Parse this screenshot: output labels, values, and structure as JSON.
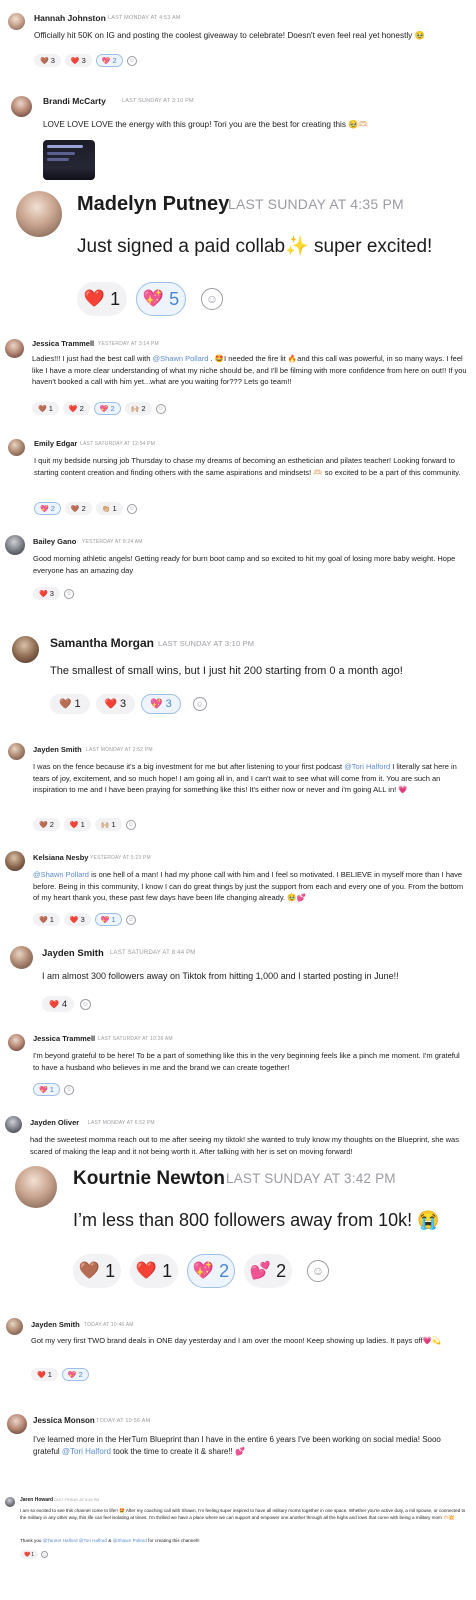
{
  "messages": [
    {
      "name": "Hannah Johnston",
      "time": "LAST MONDAY AT 4:53 AM",
      "text": "Officially hit 50K on IG and posting the coolest giveaway to celebrate! Doesn't even feel real yet honestly 🥹",
      "reactions": [
        {
          "emoji": "🤎",
          "count": "3",
          "mine": false
        },
        {
          "emoji": "❤️",
          "count": "3",
          "mine": false
        },
        {
          "emoji": "💖",
          "count": "2",
          "mine": true
        }
      ]
    },
    {
      "name": "Brandi McCarty",
      "time": "LAST SUNDAY AT 3:10 PM",
      "text": "LOVE LOVE LOVE the energy with this group! Tori you are the best for creating this 🥹🫶🏻",
      "reactions": []
    },
    {
      "name": "Madelyn Putney",
      "time": "LAST SUNDAY AT 4:35 PM",
      "text": "Just signed a paid collab✨ super excited!",
      "reactions": [
        {
          "emoji": "❤️",
          "count": "1",
          "mine": false
        },
        {
          "emoji": "💖",
          "count": "5",
          "mine": true
        }
      ]
    },
    {
      "name": "Jessica Trammell",
      "time": "YESTERDAY AT 3:14 PM",
      "text_a": "Ladies!!! I just had the best call with ",
      "mention": "@Shawn Pollard",
      "text_b": " . 🤩I needed the fire lit 🔥and this call was powerful, in so many ways. I feel like I have a more clear understanding of what my niche should be, and I'll be filming with more confidence from here on out!! If you haven't booked a call with him yet...what are you waiting for??? Lets go team!!",
      "reactions": [
        {
          "emoji": "🤎",
          "count": "1",
          "mine": false
        },
        {
          "emoji": "❤️",
          "count": "2",
          "mine": false
        },
        {
          "emoji": "💖",
          "count": "2",
          "mine": true
        },
        {
          "emoji": "🙌🏼",
          "count": "2",
          "mine": false
        }
      ]
    },
    {
      "name": "Emily Edgar",
      "time": "LAST SATURDAY AT 12:54 PM",
      "text": "I quit my bedside nursing job Thursday to chase my dreams of becoming an esthetician and pilates teacher! Looking forward to starting content creation and finding others with the same aspirations and mindsets! 🫶🏻 so excited to be a part of this community.",
      "reactions": [
        {
          "emoji": "💖",
          "count": "2",
          "mine": true
        },
        {
          "emoji": "🤎",
          "count": "2",
          "mine": false
        },
        {
          "emoji": "👏🏼",
          "count": "1",
          "mine": false
        }
      ]
    },
    {
      "name": "Bailey Gano",
      "time": "YESTERDAY AT 8:24 AM",
      "text": "Good morning athletic angels! Getting ready for burn boot camp and so excited to hit my goal of losing more baby weight. Hope everyone has an amazing day",
      "reactions": [
        {
          "emoji": "❤️",
          "count": "3",
          "mine": false
        }
      ]
    },
    {
      "name": "Samantha Morgan",
      "time": "LAST SUNDAY AT 3:10 PM",
      "text": "The smallest of small wins, but I just hit 200 starting from 0 a month ago!",
      "reactions": [
        {
          "emoji": "🤎",
          "count": "1",
          "mine": false
        },
        {
          "emoji": "❤️",
          "count": "3",
          "mine": false
        },
        {
          "emoji": "💖",
          "count": "3",
          "mine": true
        }
      ]
    },
    {
      "name": "Jayden Smith",
      "time": "LAST MONDAY AT 2:52 PM",
      "text_a": "I was on the fence because it's a big investment for me but after listening to your first podcast ",
      "mention": "@Tori Halford",
      "text_b": " I literally sat here in tears of joy, excitement, and so much hope! I am going all in, and I can't wait to see what will come from it. You are such an inspiration to me and I have been praying for something like this! It's either now or never and i'm going ALL in! 💗",
      "reactions": [
        {
          "emoji": "🤎",
          "count": "2",
          "mine": false
        },
        {
          "emoji": "❤️",
          "count": "1",
          "mine": false
        },
        {
          "emoji": "🙌🏼",
          "count": "1",
          "mine": false
        }
      ]
    },
    {
      "name": "Kelsiana Nesby",
      "time": "YESTERDAY AT 5:23 PM",
      "mention": "@Shawn Pollard",
      "text_b": " is one hell of a man! I had my phone call with him and I feel so motivated. I BELIEVE in myself more than I have before. Being in this community, I know I can do great things by just the support from each and every one of you. From the bottom of my heart thank you, these past few days have been life changing already. 🥹💕",
      "reactions": [
        {
          "emoji": "🤎",
          "count": "1",
          "mine": false
        },
        {
          "emoji": "❤️",
          "count": "3",
          "mine": false
        },
        {
          "emoji": "💖",
          "count": "1",
          "mine": true
        }
      ]
    },
    {
      "name": "Jayden Smith",
      "time": "LAST SATURDAY AT 8:44 PM",
      "text": "I am almost 300 followers away on Tiktok from hitting 1,000 and I started posting in June!!",
      "reactions": [
        {
          "emoji": "❤️",
          "count": "4",
          "mine": false
        }
      ]
    },
    {
      "name": "Jessica Trammell",
      "time": "LAST SATURDAY AT 10:26 AM",
      "text": "I'm beyond grateful to be here! To be a part of something like this in the very beginning feels like a pinch me moment. I'm grateful to have a husband who believes in me and the brand we can create together!",
      "reactions": [
        {
          "emoji": "💖",
          "count": "1",
          "mine": true
        }
      ]
    },
    {
      "name": "Jayden Oliver",
      "time": "LAST MONDAY AT 6:52 PM",
      "text": "had the sweetest momma reach out to me after seeing my tiktok! she wanted to truly know my thoughts on the Blueprint, she was scared of making the leap and it not being worth it. After talking with her is set on moving forward!",
      "reactions": []
    },
    {
      "name": "Kourtnie Newton",
      "time": "LAST SUNDAY AT 3:42 PM",
      "text": "I’m less than 800 followers away from 10k! 😭",
      "reactions": [
        {
          "emoji": "🤎",
          "count": "1",
          "mine": false
        },
        {
          "emoji": "❤️",
          "count": "1",
          "mine": false
        },
        {
          "emoji": "💖",
          "count": "2",
          "mine": true
        },
        {
          "emoji": "💕",
          "count": "2",
          "mine": false
        }
      ]
    },
    {
      "name": "Jayden Smith",
      "time": "TODAY AT 10:46 AM",
      "text": "Got my very first TWO brand deals in ONE day yesterday and I am over the moon! Keep showing up ladies. It pays off💗💫",
      "reactions": [
        {
          "emoji": "❤️",
          "count": "1",
          "mine": false
        },
        {
          "emoji": "💖",
          "count": "2",
          "mine": true
        }
      ]
    },
    {
      "name": "Jessica Monson",
      "time": "TODAY AT 10:56 AM",
      "text_a": "I've learned more in the HerTurn Blueprint than I have in the entire 6 years I've been working on social media! Sooo grateful ",
      "mention": "@Tori Halford",
      "text_b": " took the time to create it & share!! 💕",
      "reactions": []
    },
    {
      "name": "Jaren Howard",
      "time": "LAST FRIDAY AT 6:46 PM",
      "text": "I am so excited to see this channel come to life!! 🤩 After my coaching call with Shawn, I'm feeling super inspired to have all military moms together in one space. Whether you're active duty, a mil spouse, or connected to the military in any other way, this life can feel isolating at times. I'm thrilled we have a place where we can support and empower one another through all the highs and lows that come with being a military mom 🫶🏻💥",
      "text2_a": "Thank you ",
      "mention2": "@Tanner Halford @Tori Halford",
      "text2_amp": " & ",
      "mention3": "@Shawn Pollard",
      "text2_b": " for creating this channel!!",
      "reactions": [
        {
          "emoji": "❤️",
          "count": "1",
          "mine": false
        }
      ]
    }
  ]
}
